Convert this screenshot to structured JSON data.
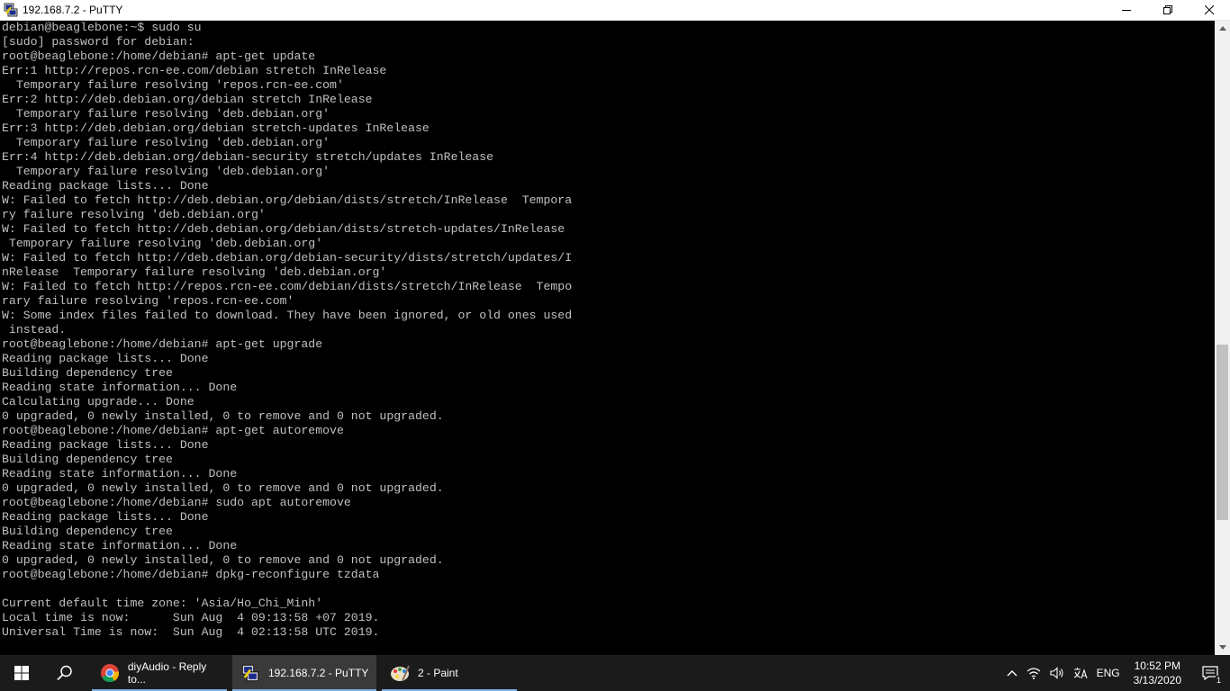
{
  "window": {
    "title": "192.168.7.2 - PuTTY",
    "app_icon": "putty-icon"
  },
  "terminal": {
    "lines": [
      "debian@beaglebone:~$ sudo su",
      "[sudo] password for debian:",
      "root@beaglebone:/home/debian# apt-get update",
      "Err:1 http://repos.rcn-ee.com/debian stretch InRelease",
      "  Temporary failure resolving 'repos.rcn-ee.com'",
      "Err:2 http://deb.debian.org/debian stretch InRelease",
      "  Temporary failure resolving 'deb.debian.org'",
      "Err:3 http://deb.debian.org/debian stretch-updates InRelease",
      "  Temporary failure resolving 'deb.debian.org'",
      "Err:4 http://deb.debian.org/debian-security stretch/updates InRelease",
      "  Temporary failure resolving 'deb.debian.org'",
      "Reading package lists... Done",
      "W: Failed to fetch http://deb.debian.org/debian/dists/stretch/InRelease  Tempora",
      "ry failure resolving 'deb.debian.org'",
      "W: Failed to fetch http://deb.debian.org/debian/dists/stretch-updates/InRelease",
      " Temporary failure resolving 'deb.debian.org'",
      "W: Failed to fetch http://deb.debian.org/debian-security/dists/stretch/updates/I",
      "nRelease  Temporary failure resolving 'deb.debian.org'",
      "W: Failed to fetch http://repos.rcn-ee.com/debian/dists/stretch/InRelease  Tempo",
      "rary failure resolving 'repos.rcn-ee.com'",
      "W: Some index files failed to download. They have been ignored, or old ones used",
      " instead.",
      "root@beaglebone:/home/debian# apt-get upgrade",
      "Reading package lists... Done",
      "Building dependency tree",
      "Reading state information... Done",
      "Calculating upgrade... Done",
      "0 upgraded, 0 newly installed, 0 to remove and 0 not upgraded.",
      "root@beaglebone:/home/debian# apt-get autoremove",
      "Reading package lists... Done",
      "Building dependency tree",
      "Reading state information... Done",
      "0 upgraded, 0 newly installed, 0 to remove and 0 not upgraded.",
      "root@beaglebone:/home/debian# sudo apt autoremove",
      "Reading package lists... Done",
      "Building dependency tree",
      "Reading state information... Done",
      "0 upgraded, 0 newly installed, 0 to remove and 0 not upgraded.",
      "root@beaglebone:/home/debian# dpkg-reconfigure tzdata",
      "",
      "Current default time zone: 'Asia/Ho_Chi_Minh'",
      "Local time is now:      Sun Aug  4 09:13:58 +07 2019.",
      "Universal Time is now:  Sun Aug  4 02:13:58 UTC 2019."
    ],
    "text_color": "#c0c0c0",
    "background": "#000000"
  },
  "taskbar": {
    "apps": [
      {
        "label": "diyAudio - Reply to...",
        "icon": "chrome-icon",
        "active": false
      },
      {
        "label": "192.168.7.2 - PuTTY",
        "icon": "putty-icon",
        "active": true
      },
      {
        "label": "2 - Paint",
        "icon": "paint-icon",
        "active": false
      }
    ],
    "tray": {
      "language": "ENG",
      "time": "10:52 PM",
      "date": "3/13/2020",
      "notification_count": "1"
    },
    "accent": "#7aaee0"
  }
}
